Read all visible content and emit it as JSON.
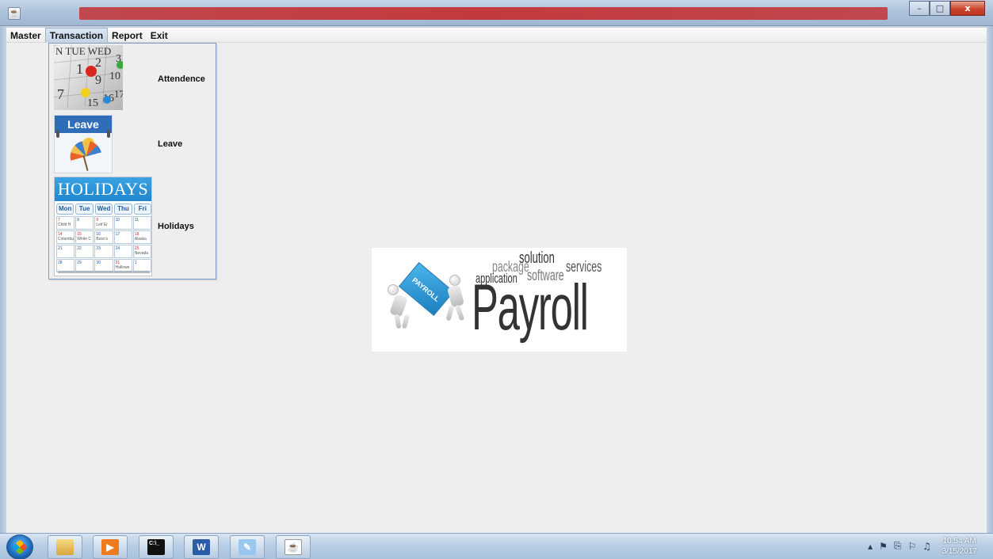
{
  "window": {
    "title": "",
    "controls": {
      "minimize": "–",
      "maximize": "□",
      "close": "x"
    }
  },
  "menubar": {
    "items": [
      {
        "label": "Master",
        "active": false
      },
      {
        "label": "Transaction",
        "active": true
      },
      {
        "label": "Report",
        "active": false
      },
      {
        "label": "Exit",
        "active": false
      }
    ]
  },
  "transaction_menu": {
    "items": [
      {
        "label": "Attendence",
        "icon": "calendar-pins-icon"
      },
      {
        "label": "Leave",
        "icon": "leave-umbrella-icon"
      },
      {
        "label": "Holidays",
        "icon": "holidays-calendar-icon"
      }
    ],
    "leave_image_text": "Leave",
    "calendar_image_text": {
      "header": "N TUE WED",
      "n1": "1",
      "n2": "2",
      "n3": "3",
      "n9": "9",
      "n10": "10",
      "n7": "7",
      "n15": "15",
      "n16": "16",
      "n17": "17"
    },
    "holidays_image": {
      "title": "HOLIDAYS",
      "days": [
        "Mon",
        "Tue",
        "Wed",
        "Thu",
        "Fri"
      ],
      "cells": [
        {
          "n": "7",
          "note": "Child H",
          "red": true
        },
        {
          "n": "8",
          "note": "",
          "red": false
        },
        {
          "n": "9",
          "note": "Leif Er",
          "red": true
        },
        {
          "n": "10",
          "note": "",
          "red": false
        },
        {
          "n": "11",
          "note": "",
          "red": false
        },
        {
          "n": "14",
          "note": "Columbu",
          "red": true
        },
        {
          "n": "15",
          "note": "White C",
          "red": true
        },
        {
          "n": "16",
          "note": "Boss's",
          "red": false
        },
        {
          "n": "17",
          "note": "",
          "red": false
        },
        {
          "n": "18",
          "note": "Alaska",
          "red": true
        },
        {
          "n": "21",
          "note": "",
          "red": false
        },
        {
          "n": "22",
          "note": "",
          "red": false
        },
        {
          "n": "23",
          "note": "",
          "red": false
        },
        {
          "n": "24",
          "note": "",
          "red": false
        },
        {
          "n": "25",
          "note": "Nevada",
          "red": true
        },
        {
          "n": "28",
          "note": "",
          "red": false
        },
        {
          "n": "29",
          "note": "",
          "red": false
        },
        {
          "n": "30",
          "note": "",
          "red": false
        },
        {
          "n": "31",
          "note": "Hallowe",
          "red": true
        },
        {
          "n": "1",
          "note": "",
          "red": false
        }
      ]
    }
  },
  "logo": {
    "main": "Payroll",
    "words": [
      "solution",
      "package",
      "services",
      "application",
      "software"
    ],
    "box_text": "PAYROLL"
  },
  "taskbar": {
    "buttons": [
      {
        "name": "explorer",
        "glyph": "",
        "color": "#e8b94a"
      },
      {
        "name": "media-player",
        "glyph": "▶",
        "color": "#f07a1e"
      },
      {
        "name": "command-prompt",
        "glyph": "C:\\_",
        "color": "#111111"
      },
      {
        "name": "word",
        "glyph": "W",
        "color": "#2a5caa"
      },
      {
        "name": "paint",
        "glyph": "✎",
        "color": "#9ac7ef"
      },
      {
        "name": "java",
        "glyph": "☕",
        "color": "#ffffff"
      }
    ],
    "tray_icons": [
      "▴",
      "⚑",
      "⎘",
      "⚐",
      "♫"
    ],
    "time": "10:54 AM",
    "date": "3/15/2017"
  },
  "colors": {
    "title_strip": "#c23a3d",
    "menu_border": "#7a9cc8",
    "holidays_blue": "#2086cf",
    "leave_blue": "#2f6db8"
  }
}
